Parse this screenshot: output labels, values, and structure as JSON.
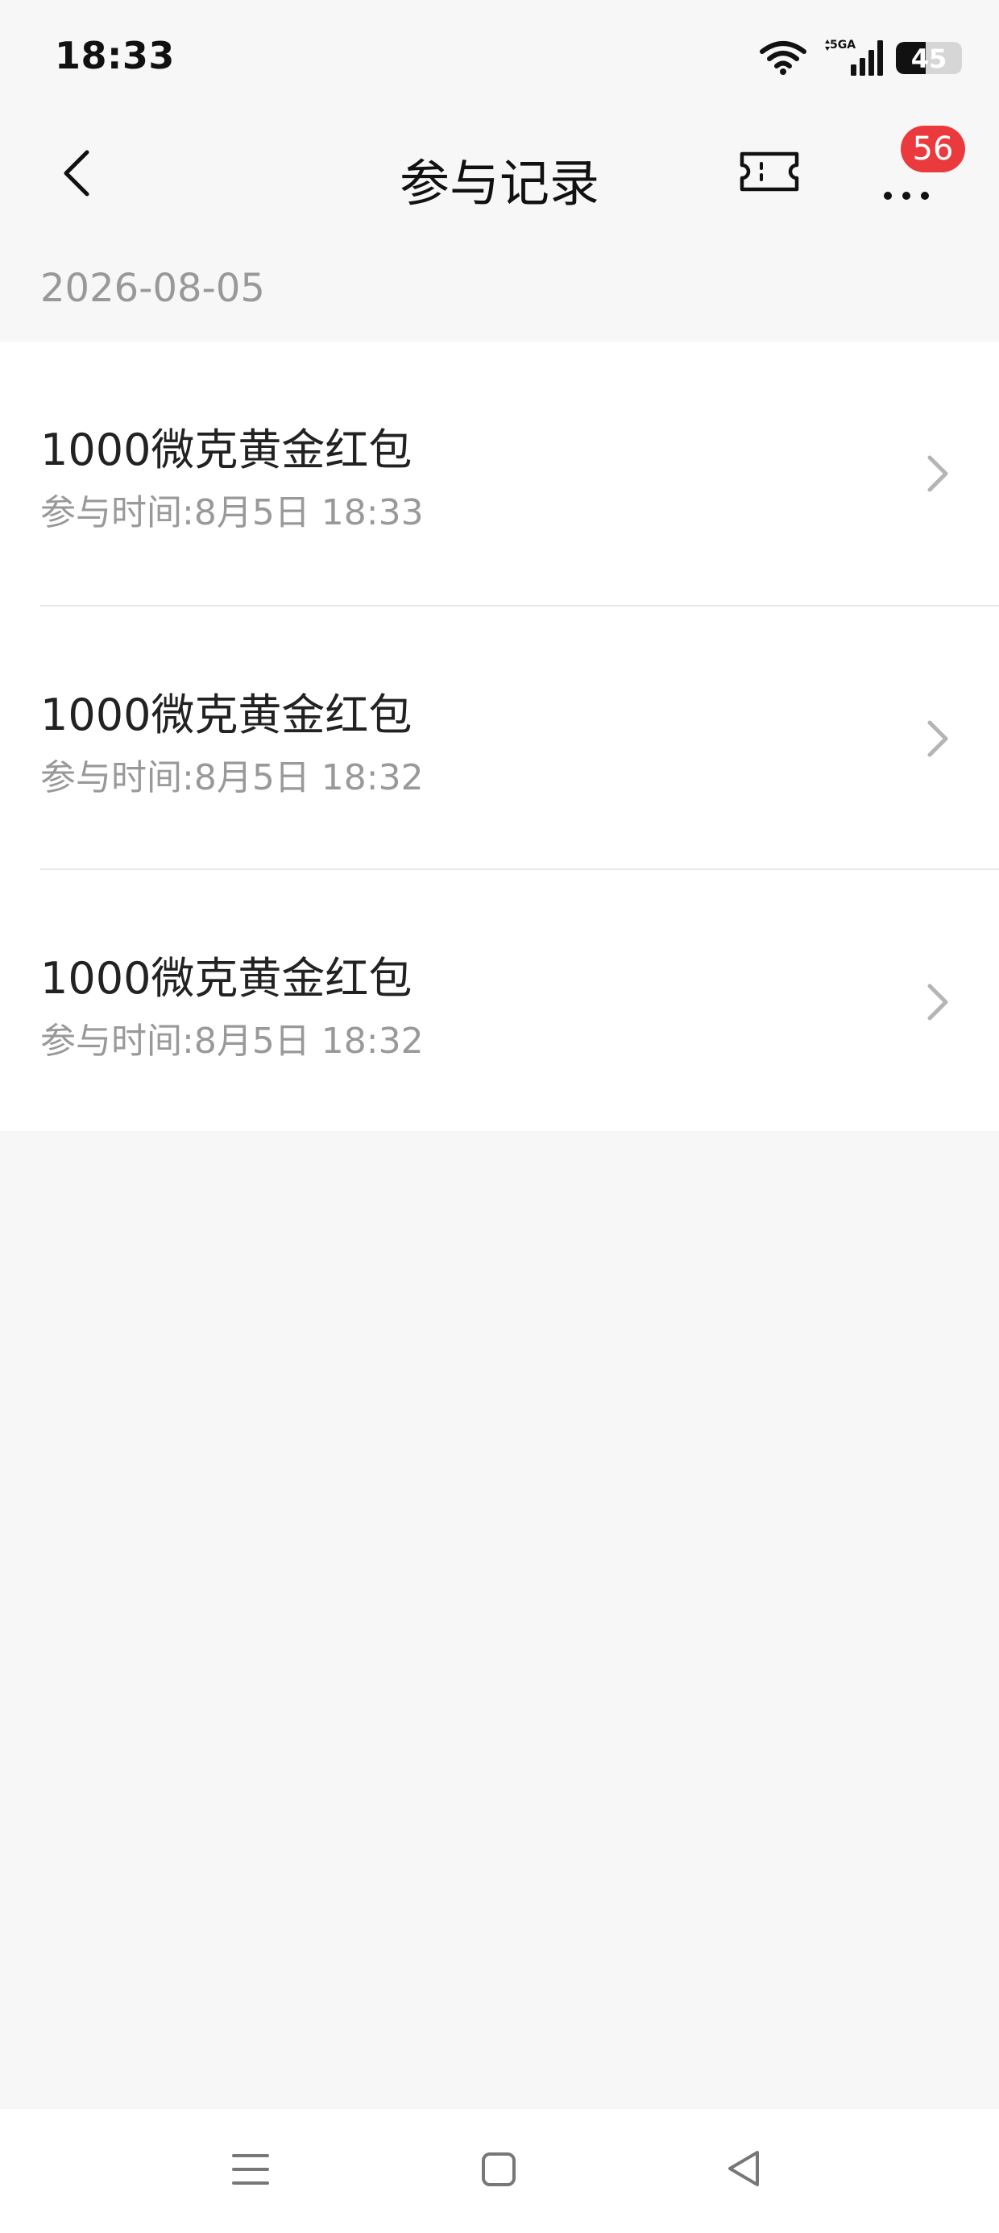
{
  "status_bar": {
    "time": "18:33",
    "network_label": "5GA",
    "battery_level": "45"
  },
  "nav": {
    "title": "参与记录",
    "badge_count": "56"
  },
  "date_header": "2026-08-05",
  "records": [
    {
      "title": "1000微克黄金红包",
      "time": "参与时间:8月5日 18:33"
    },
    {
      "title": "1000微克黄金红包",
      "time": "参与时间:8月5日 18:32"
    },
    {
      "title": "1000微克黄金红包",
      "time": "参与时间:8月5日 18:32"
    }
  ],
  "icons": {
    "back": "chevron-left-icon",
    "ticket": "ticket-icon",
    "more": "more-dots-icon",
    "row_arrow": "chevron-right-icon",
    "sys_menu": "menu-lines-icon",
    "sys_home": "square-home-icon",
    "sys_back": "triangle-back-icon"
  },
  "colors": {
    "background": "#f7f7f7",
    "card": "#ffffff",
    "badge": "#ea3a3d",
    "secondary_text": "#999999"
  }
}
